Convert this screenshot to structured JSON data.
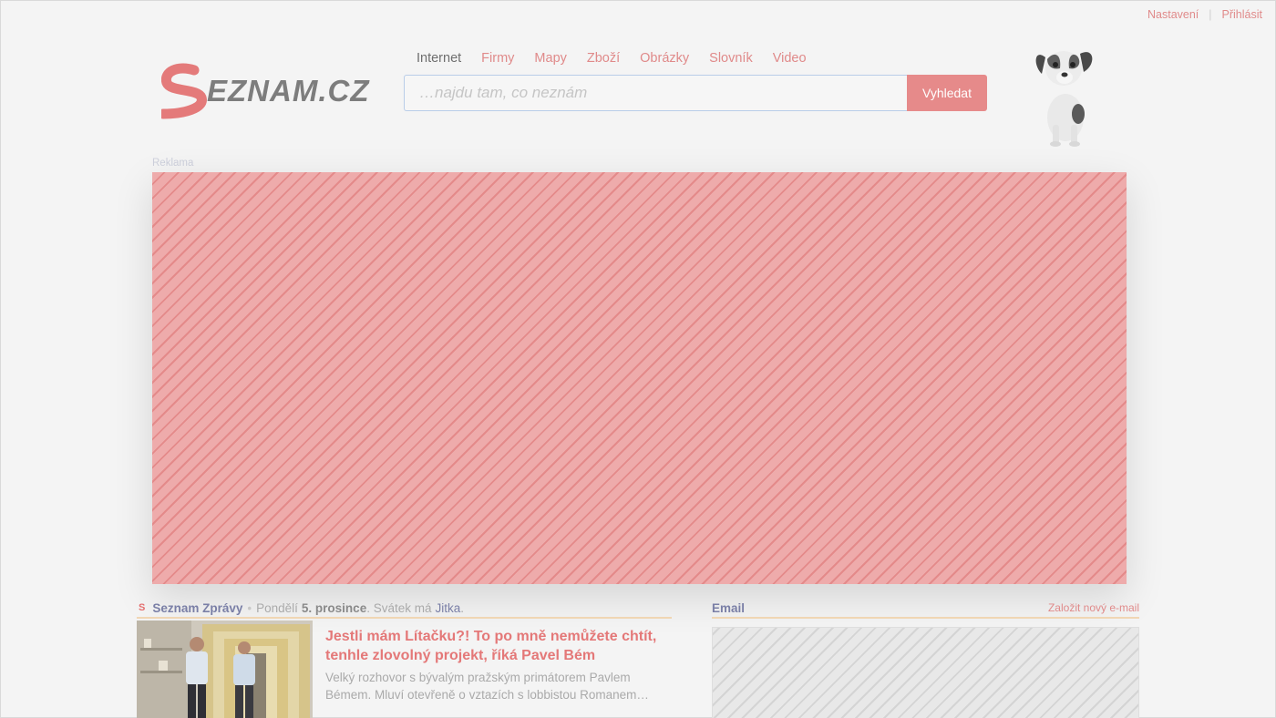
{
  "top_links": {
    "settings": "Nastavení",
    "separator": "|",
    "login": "Přihlásit"
  },
  "logo": {
    "text": "SEZNAM.CZ",
    "accent_color": "#e47a7a"
  },
  "nav": [
    {
      "label": "Internet",
      "active": true
    },
    {
      "label": "Firmy",
      "active": false
    },
    {
      "label": "Mapy",
      "active": false
    },
    {
      "label": "Zboží",
      "active": false
    },
    {
      "label": "Obrázky",
      "active": false
    },
    {
      "label": "Slovník",
      "active": false
    },
    {
      "label": "Video",
      "active": false
    }
  ],
  "search": {
    "placeholder": "…najdu tam, co neznám",
    "value": "",
    "button_label": "Vyhledat"
  },
  "ad": {
    "label": "Reklama",
    "color": "#eeabab"
  },
  "news": {
    "brand": "Seznam Zprávy",
    "separator": "•",
    "day": "Pondělí",
    "date": "5. prosince",
    "nameday_prefix": ". Svátek má",
    "nameday_name": "Jitka",
    "nameday_suffix": ".",
    "article": {
      "title": "Jestli mám Lítačku?! To po mně nemůžete chtít, tenhle zlovolný projekt, říká Pavel Bém",
      "description": "Velký rozhovor s bývalým pražským primátorem Pavlem Bémem. Mluví otevřeně o vztazích s lobbistou Romanem…"
    }
  },
  "email": {
    "title": "Email",
    "create_link": "Založit nový e-mail"
  }
}
